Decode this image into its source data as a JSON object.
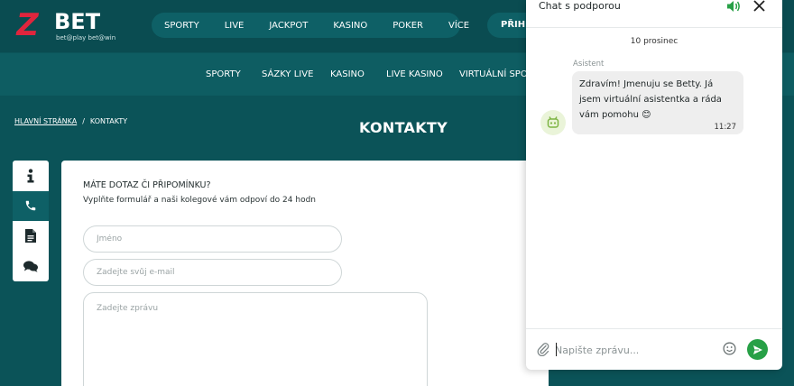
{
  "header": {
    "logo_mark": "Z",
    "logo_text": "BET",
    "logo_tagline": "bet@play bet@win",
    "nav": [
      "SPORTY",
      "LIVE",
      "JACKPOT",
      "KASINO",
      "POKER",
      "VÍCE"
    ],
    "login_label": "PŘIHL"
  },
  "subnav": [
    "SPORTY",
    "SÁZKY LIVE",
    "KASINO",
    "LIVE KASINO",
    "VIRTUÁLNÍ SPORT"
  ],
  "breadcrumb": {
    "home": "HLAVNÍ STRÁNKA",
    "separator": "/",
    "current": "KONTAKTY"
  },
  "page_title": "KONTAKTY",
  "side_tabs": [
    {
      "icon": "info-icon",
      "active": false
    },
    {
      "icon": "phone-icon",
      "active": true
    },
    {
      "icon": "document-icon",
      "active": false
    },
    {
      "icon": "chat-bubbles-icon",
      "active": false
    }
  ],
  "form": {
    "question": "MÁTE DOTAZ ČI PŘIPOMÍNKU?",
    "description": "Vyplňte formulář a naši kolegové vám odpoví do 24 hodn",
    "name_placeholder": "Jméno",
    "email_placeholder": "Zadejte svůj e-mail",
    "message_placeholder": "Zadejte zprávu"
  },
  "chat": {
    "title": "Chat s podporou",
    "date": "10 prosinec",
    "sender": "Asistent",
    "message": "Zdravím! Jmenuju se Betty. Já jsem virtuální asistentka a ráda vám pomohu 😊",
    "time": "11:27",
    "input_placeholder": "Napište zprávu...",
    "accent_color": "#27a046"
  },
  "colors": {
    "brand_teal": "#0b5358",
    "logo_red": "#e0253d"
  }
}
